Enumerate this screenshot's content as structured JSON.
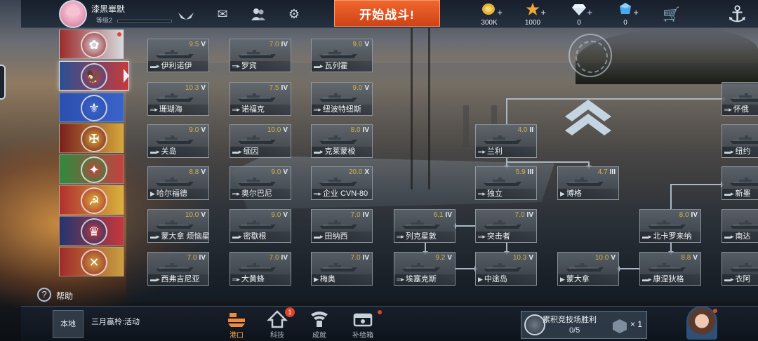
{
  "player": {
    "name": "漆黑崋默",
    "level": "等级2",
    "xp_fraction": 0.0
  },
  "header": {
    "battle_label": "开始战斗!",
    "resources": [
      {
        "icon": "gold-coin-icon",
        "value": "300K",
        "color": "#e6b43a"
      },
      {
        "icon": "star-icon",
        "value": "1000",
        "color": "#f0a63a"
      },
      {
        "icon": "diamond-icon",
        "value": "0",
        "color": "#d8e6f2"
      },
      {
        "icon": "blue-crystal-icon",
        "value": "0",
        "color": "#4aa8ee"
      }
    ]
  },
  "nations": [
    {
      "name": "nation-japan",
      "colors": [
        "#9a2b2b",
        "#d7dbe0"
      ],
      "symbol": "✿",
      "alert": true
    },
    {
      "name": "nation-usa",
      "colors": [
        "#2a4f94",
        "#c73a3a"
      ],
      "symbol": "🦅",
      "active": true
    },
    {
      "name": "nation-france",
      "colors": [
        "#2c4fb0",
        "#3a63c8"
      ],
      "symbol": "⚜"
    },
    {
      "name": "nation-germany",
      "colors": [
        "#7a1f1f",
        "#d4a83a"
      ],
      "symbol": "✠"
    },
    {
      "name": "nation-italy",
      "colors": [
        "#2e8a3e",
        "#c84040"
      ],
      "symbol": "✦"
    },
    {
      "name": "nation-ussr",
      "colors": [
        "#b23030",
        "#d8b23a"
      ],
      "symbol": "☭"
    },
    {
      "name": "nation-uk",
      "colors": [
        "#23356e",
        "#c8363a"
      ],
      "symbol": "♛"
    },
    {
      "name": "nation-misc",
      "colors": [
        "#a02a2a",
        "#c8a040"
      ],
      "symbol": "✕"
    }
  ],
  "ships": [
    {
      "id": "s1",
      "name": "伊利诺伊",
      "cls": "▬▸",
      "stars": "9.5",
      "tier": "V"
    },
    {
      "id": "s2",
      "name": "罗宾",
      "cls": "═▸",
      "stars": "7.0",
      "tier": "IV"
    },
    {
      "id": "s3",
      "name": "瓦列霍",
      "cls": "▬▸",
      "stars": "9.0",
      "tier": "V"
    },
    {
      "id": "s4",
      "name": "珊瑚海",
      "cls": "═▸",
      "stars": "10.3",
      "tier": "V"
    },
    {
      "id": "s5",
      "name": "诺福克",
      "cls": "═▸",
      "stars": "7.5",
      "tier": "IV"
    },
    {
      "id": "s6",
      "name": "纽波特纽斯",
      "cls": "═▸",
      "stars": "9.0",
      "tier": "V"
    },
    {
      "id": "s7",
      "name": "关岛",
      "cls": "▬▸",
      "stars": "9.0",
      "tier": "V"
    },
    {
      "id": "s8",
      "name": "缅因",
      "cls": "▬▸",
      "stars": "10.0",
      "tier": "V"
    },
    {
      "id": "s9",
      "name": "克莱蒙梭",
      "cls": "▬▸",
      "stars": "8.0",
      "tier": "IV"
    },
    {
      "id": "s10",
      "name": "哈尔福德",
      "cls": "▶",
      "stars": "8.8",
      "tier": "V"
    },
    {
      "id": "s11",
      "name": "奥尔巴尼",
      "cls": "═▸",
      "stars": "9.0",
      "tier": "V"
    },
    {
      "id": "s12",
      "name": "企业 CVN-80",
      "cls": "═▸",
      "stars": "20.0",
      "tier": "X"
    },
    {
      "id": "s13",
      "name": "蒙大拿 烦恼星河",
      "cls": "▬▸",
      "stars": "10.0",
      "tier": "V"
    },
    {
      "id": "s14",
      "name": "密歇根",
      "cls": "▬▸",
      "stars": "9.0",
      "tier": "V"
    },
    {
      "id": "s15",
      "name": "田纳西",
      "cls": "▬▸",
      "stars": "7.0",
      "tier": "IV"
    },
    {
      "id": "s16",
      "name": "西弗吉尼亚",
      "cls": "▬▸",
      "stars": "7.0",
      "tier": "IV"
    },
    {
      "id": "s17",
      "name": "大黄蜂",
      "cls": "═▸",
      "stars": "7.0",
      "tier": "IV"
    },
    {
      "id": "s18",
      "name": "梅奥",
      "cls": "▶",
      "stars": "7.0",
      "tier": "IV"
    },
    {
      "id": "t1",
      "name": "兰利",
      "cls": "═▸",
      "stars": "4.0",
      "tier": "II"
    },
    {
      "id": "t2",
      "name": "独立",
      "cls": "═▸",
      "stars": "5.9",
      "tier": "III"
    },
    {
      "id": "t3",
      "name": "博格",
      "cls": "▶",
      "stars": "4.7",
      "tier": "III"
    },
    {
      "id": "t4",
      "name": "列克星敦",
      "cls": "═▸",
      "stars": "6.1",
      "tier": "IV"
    },
    {
      "id": "t5",
      "name": "突击者",
      "cls": "═▸",
      "stars": "7.0",
      "tier": "IV"
    },
    {
      "id": "t6",
      "name": "埃塞克斯",
      "cls": "═▸",
      "stars": "9.2",
      "tier": "V"
    },
    {
      "id": "t7",
      "name": "中途岛",
      "cls": "▶",
      "stars": "10.3",
      "tier": "V"
    },
    {
      "id": "t8",
      "name": "蒙大拿",
      "cls": "▶",
      "stars": "10.0",
      "tier": "V"
    },
    {
      "id": "t9",
      "name": "北卡罗来纳",
      "cls": "▬▸",
      "stars": "8.0",
      "tier": "IV"
    },
    {
      "id": "t10",
      "name": "康涅狄格",
      "cls": "▬▸",
      "stars": "8.8",
      "tier": "V"
    },
    {
      "id": "r1",
      "name": "怀俄",
      "cls": "═▸",
      "stars": "",
      "tier": ""
    },
    {
      "id": "r2",
      "name": "纽约",
      "cls": "▬▸",
      "stars": "",
      "tier": ""
    },
    {
      "id": "r3",
      "name": "新墨",
      "cls": "▬▸",
      "stars": "",
      "tier": ""
    },
    {
      "id": "r4",
      "name": "南达",
      "cls": "▬▸",
      "stars": "",
      "tier": ""
    },
    {
      "id": "r5",
      "name": "衣阿",
      "cls": "▬▸",
      "stars": "",
      "tier": ""
    }
  ],
  "help": {
    "label": "帮助"
  },
  "bottom": {
    "channel_label": "本地",
    "event_text": "三月蠃柃:活动",
    "nav": [
      {
        "icon": "harbor-icon",
        "label": "港口",
        "active": true
      },
      {
        "icon": "tech-icon",
        "label": "科技",
        "badge": "1"
      },
      {
        "icon": "achievement-icon",
        "label": "成就"
      },
      {
        "icon": "supply-box-icon",
        "label": "补给箱",
        "dot": true
      }
    ],
    "arena": {
      "title": "累积竞技场胜利",
      "progress": "0/5",
      "reward_count": "× 1"
    }
  }
}
